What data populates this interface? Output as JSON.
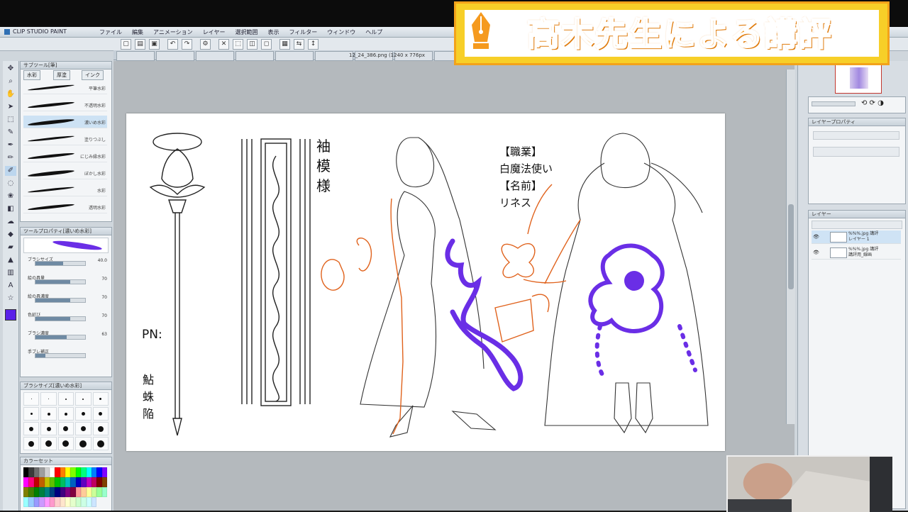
{
  "app": {
    "title": "CLIP STUDIO PAINT",
    "menu": [
      "ファイル",
      "編集",
      "アニメーション",
      "レイヤー",
      "選択範囲",
      "表示",
      "フィルター",
      "ウィンドウ",
      "ヘルプ"
    ],
    "tabs": [
      "",
      "",
      "",
      "",
      "",
      "",
      "",
      "",
      "",
      "",
      "",
      "",
      "",
      "",
      "",
      ""
    ],
    "file_info": "12_24_386.png (1240 x 776px"
  },
  "overlay": {
    "critique_title": "高木先生による講評"
  },
  "subtool": {
    "header": "サブツール[筆]",
    "tabs": [
      "水彩",
      "厚塗",
      "インク"
    ],
    "brushes": [
      {
        "label": "平筆水彩"
      },
      {
        "label": "不透明水彩"
      },
      {
        "label": "濃いめ水彩"
      },
      {
        "label": "塗りつぶし"
      },
      {
        "label": "にじみ縁水彩"
      },
      {
        "label": "ぼかし水彩"
      },
      {
        "label": "水彩"
      },
      {
        "label": "透明水彩"
      }
    ]
  },
  "toolprop": {
    "header": "ツールプロパティ[濃いめ水彩]",
    "rows": [
      {
        "label": "ブラシサイズ",
        "value": "40.0",
        "fill": 0.55
      },
      {
        "label": "絵の具量",
        "value": "70",
        "fill": 0.7
      },
      {
        "label": "絵の具濃度",
        "value": "70",
        "fill": 0.7
      },
      {
        "label": "色延び",
        "value": "70",
        "fill": 0.7
      },
      {
        "label": "ブラシ濃度",
        "value": "63",
        "fill": 0.63
      },
      {
        "label": "手ブレ補正",
        "value": "",
        "fill": 0.2
      }
    ]
  },
  "sizepalette": {
    "header": "ブラシサイズ[濃いめ水彩]"
  },
  "colorpalette": {
    "header": "カラーセット",
    "colors": [
      "#000000",
      "#3a3a3a",
      "#6e6e6e",
      "#9e9e9e",
      "#d0d0d0",
      "#ffffff",
      "#ff0000",
      "#ff7f00",
      "#ffff00",
      "#7fff00",
      "#00ff00",
      "#00ff7f",
      "#00ffff",
      "#007fff",
      "#0000ff",
      "#7f00ff",
      "#ff00ff",
      "#ff007f",
      "#c00000",
      "#c06000",
      "#c0c000",
      "#60c000",
      "#00c000",
      "#00c060",
      "#00c0c0",
      "#0060c0",
      "#0000c0",
      "#6000c0",
      "#c000c0",
      "#c00060",
      "#800000",
      "#804000",
      "#808000",
      "#408000",
      "#008000",
      "#008040",
      "#008080",
      "#004080",
      "#000080",
      "#400080",
      "#800080",
      "#800040",
      "#ff9999",
      "#ffcc99",
      "#ffff99",
      "#ccff99",
      "#99ff99",
      "#99ffcc",
      "#99ffff",
      "#99ccff",
      "#9999ff",
      "#cc99ff",
      "#ff99ff",
      "#ff99cc",
      "#ffcccc",
      "#ffe5cc",
      "#ffffcc",
      "#e5ffcc",
      "#ccffcc",
      "#ccffe5",
      "#ccffff",
      "#cce5ff"
    ]
  },
  "layers": {
    "header": "レイヤー",
    "property_header": "レイヤープロパティ",
    "rows": [
      {
        "name": "%%%.jpg 講評\nレイヤー 1"
      },
      {
        "name": "%%%.jpg 講評\n講評用_線画"
      }
    ]
  },
  "canvas": {
    "pn_label": "PN:",
    "pn_name": "鮎蛛陥",
    "sleeve_label": "袖模様",
    "job_header": "【職業】",
    "job_value": "白魔法使い",
    "name_header": "【名前】",
    "name_value": "リネス"
  }
}
